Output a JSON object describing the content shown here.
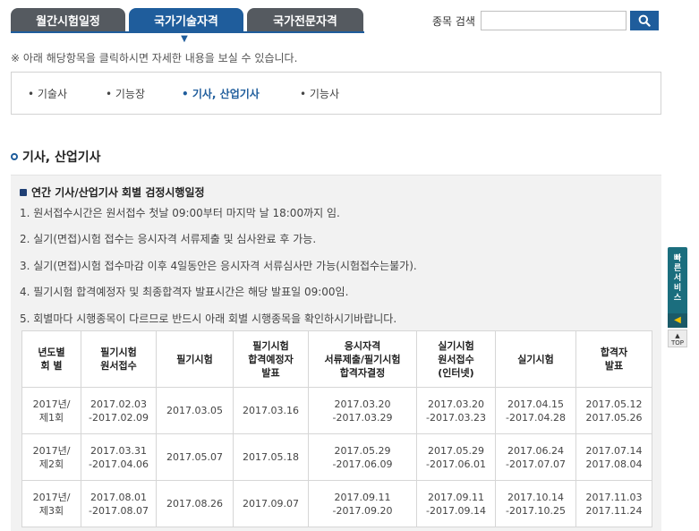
{
  "tabs": [
    {
      "label": "월간시험일정"
    },
    {
      "label": "국가기술자격"
    },
    {
      "label": "국가전문자격"
    }
  ],
  "search": {
    "label": "종목 검색",
    "value": "",
    "placeholder": ""
  },
  "notice": "※ 아래 해당항목을 클릭하시면 자세한 내용을 보실 수 있습니다.",
  "categories": [
    {
      "label": "• 기술사"
    },
    {
      "label": "• 기능장"
    },
    {
      "label": "• 기사, 산업기사"
    },
    {
      "label": "• 기능사"
    }
  ],
  "section_title": "기사, 산업기사",
  "subsection_title": "연간 기사/산업기사 회별 검정시행일정",
  "rules": [
    "1. 원서접수시간은 원서접수 첫날 09:00부터 마지막 날 18:00까지 임.",
    "2. 실기(면접)시험 접수는 응시자격 서류제출 및 심사완료 후 가능.",
    "3. 실기(면접)시험 접수마감 이후 4일동안은 응시자격 서류심사만 가능(시험접수는불가).",
    "4. 필기시험 합격예정자 및 최종합격자 발표시간은 해당 발표일 09:00임.",
    "5. 회별마다 시행종목이 다르므로 반드시 아래 회별 시행종목을 확인하시기바랍니다."
  ],
  "table": {
    "headers": [
      [
        "년도별",
        "회 별"
      ],
      [
        "필기시험",
        "원서접수"
      ],
      [
        "필기시험"
      ],
      [
        "필기시험",
        "합격예정자",
        "발표"
      ],
      [
        "응시자격",
        "서류제출/필기시험",
        "합격자결정"
      ],
      [
        "실기시험",
        "원서접수",
        "(인터넷)"
      ],
      [
        "실기시험"
      ],
      [
        "합격자",
        "발표"
      ]
    ],
    "rows": [
      [
        [
          "2017년/",
          "제1회"
        ],
        [
          "2017.02.03",
          "-2017.02.09"
        ],
        [
          "2017.03.05"
        ],
        [
          "2017.03.16"
        ],
        [
          "2017.03.20",
          "-2017.03.29"
        ],
        [
          "2017.03.20",
          "-2017.03.23"
        ],
        [
          "2017.04.15",
          "-2017.04.28"
        ],
        [
          "2017.05.12",
          "2017.05.26"
        ]
      ],
      [
        [
          "2017년/",
          "제2회"
        ],
        [
          "2017.03.31",
          "-2017.04.06"
        ],
        [
          "2017.05.07"
        ],
        [
          "2017.05.18"
        ],
        [
          "2017.05.29",
          "-2017.06.09"
        ],
        [
          "2017.05.29",
          "-2017.06.01"
        ],
        [
          "2017.06.24",
          "-2017.07.07"
        ],
        [
          "2017.07.14",
          "2017.08.04"
        ]
      ],
      [
        [
          "2017년/",
          "제3회"
        ],
        [
          "2017.08.01",
          "-2017.08.07"
        ],
        [
          "2017.08.26"
        ],
        [
          "2017.09.07"
        ],
        [
          "2017.09.11",
          "-2017.09.20"
        ],
        [
          "2017.09.11",
          "-2017.09.14"
        ],
        [
          "2017.10.14",
          "-2017.10.25"
        ],
        [
          "2017.11.03",
          "2017.11.24"
        ]
      ]
    ]
  },
  "quick_service": {
    "label": "빠른서비스",
    "top_label": "TOP"
  },
  "colors": {
    "accent": "#1f5d9c",
    "tab_inactive": "#555a60",
    "quick": "#1b6e7e"
  }
}
